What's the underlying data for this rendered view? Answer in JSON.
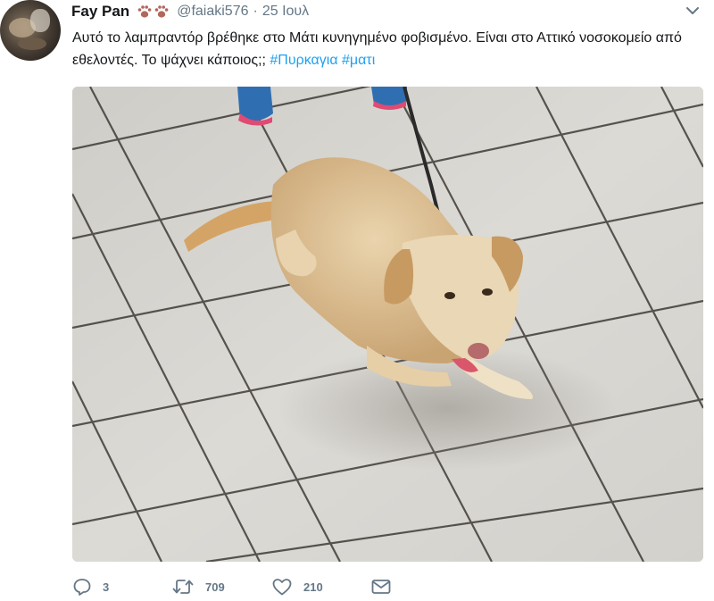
{
  "tweet": {
    "author_name": "Fay Pan",
    "handle": "@faiaki576",
    "separator": "·",
    "date": "25 Ιουλ",
    "text_before": "Αυτό το λαμπραντόρ βρέθηκε στο Μάτι κυνηγημένο φοβισμένο. Είναι στο Αττικό νοσοκομείο από  εθελοντές. Το ψάχνει κάποιος;; ",
    "hashtags": [
      "#Πυρκαγια",
      "#ματι"
    ]
  },
  "actions": {
    "reply_count": "3",
    "retweet_count": "709",
    "like_count": "210"
  },
  "icons": {
    "paws": "paw-prints-icon",
    "caret": "chevron-down-icon",
    "reply": "reply-icon",
    "retweet": "retweet-icon",
    "like": "heart-icon",
    "dm": "envelope-icon"
  },
  "colors": {
    "text": "#14171a",
    "secondary": "#657786",
    "link": "#1da1f2"
  }
}
